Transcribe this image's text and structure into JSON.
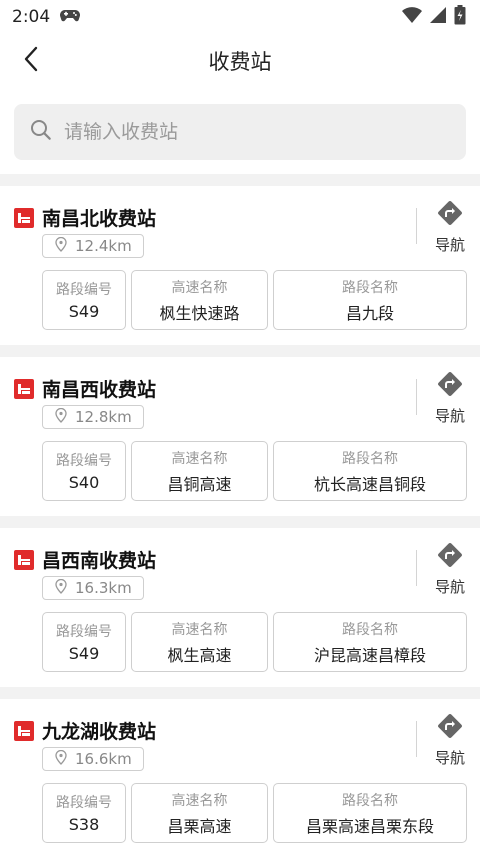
{
  "status_bar": {
    "time": "2:04"
  },
  "header": {
    "title": "收费站",
    "back_icon": "chevron-left-icon"
  },
  "search": {
    "placeholder": "请输入收费站"
  },
  "nav_label": "导航",
  "field_labels": {
    "road_code": "路段编号",
    "highway_name": "高速名称",
    "segment_name": "路段名称"
  },
  "stations": [
    {
      "name": "南昌北收费站",
      "distance": "12.4km",
      "road_code": "S49",
      "highway_name": "枫生快速路",
      "segment_name": "昌九段"
    },
    {
      "name": "南昌西收费站",
      "distance": "12.8km",
      "road_code": "S40",
      "highway_name": "昌铜高速",
      "segment_name": "杭长高速昌铜段"
    },
    {
      "name": "昌西南收费站",
      "distance": "16.3km",
      "road_code": "S49",
      "highway_name": "枫生高速",
      "segment_name": "沪昆高速昌樟段"
    },
    {
      "name": "九龙湖收费站",
      "distance": "16.6km",
      "road_code": "S38",
      "highway_name": "昌栗高速",
      "segment_name": "昌栗高速昌栗东段"
    }
  ],
  "colors": {
    "accent": "#e02b2b",
    "icon_gray": "#666666",
    "list_bg": "#f2f2f2"
  }
}
